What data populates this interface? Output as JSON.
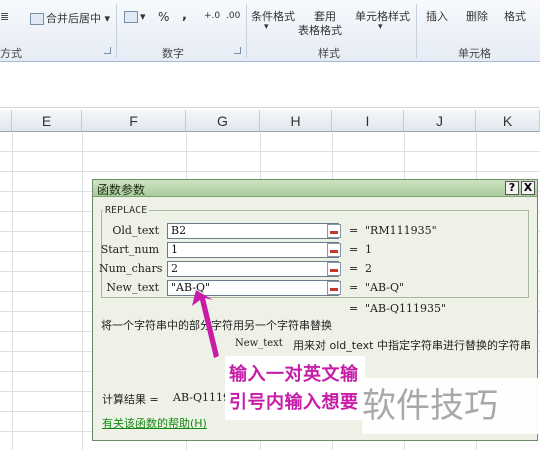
{
  "ribbon": {
    "merge_center": "合并后居中",
    "percent": "%",
    "comma": ",",
    "decimal_inc": "+.0",
    "decimal_dec": ".00",
    "conditional_format": "条件格式",
    "table_format_1": "套用",
    "table_format_2": "表格格式",
    "cell_styles": "单元格样式",
    "insert": "插入",
    "delete": "删除",
    "format": "格式",
    "groups": {
      "alignment": "方式",
      "number": "数字",
      "styles": "样式",
      "cells": "单元格"
    }
  },
  "columns": [
    "E",
    "F",
    "G",
    "H",
    "I",
    "J",
    "K"
  ],
  "dialog": {
    "title": "函数参数",
    "help_btn": "?",
    "close_btn": "X",
    "function_name": "REPLACE",
    "args": [
      {
        "label": "Old_text",
        "value": "B2",
        "result": "\"RM111935\""
      },
      {
        "label": "Start_num",
        "value": "1",
        "result": "1"
      },
      {
        "label": "Num_chars",
        "value": "2",
        "result": "2"
      },
      {
        "label": "New_text",
        "value": "\"AB-Q\"",
        "result": "\"AB-Q\""
      }
    ],
    "equals": "=",
    "formula_result": "\"AB-Q111935\"",
    "description": "将一个字符串中的部分字符用另一个字符串替换",
    "arg_help_name": "New_text",
    "arg_help_text": "用来对 old_text 中指定字符串进行替换的字符串",
    "calc_result_label": "计算结果 =",
    "calc_result_value": "AB-Q111935",
    "help_link": "有关该函数的帮助(H)"
  },
  "annotation": {
    "line1": "输入一对英文输",
    "line2": "引号内输入想要",
    "color": "#c61ca8"
  },
  "watermark": "软件技巧"
}
